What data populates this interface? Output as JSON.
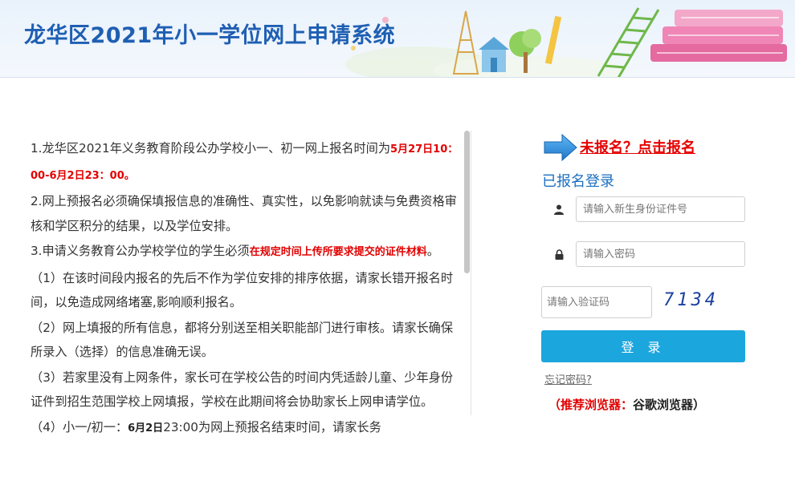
{
  "header": {
    "title": "龙华区2021年小一学位网上申请系统"
  },
  "notice": {
    "p1_text": "1.龙华区2021年义务教育阶段公办学校小一、初一网上报名时间为",
    "p1_highlight": "5月27日10：00-6月2日23：00。",
    "p2_text": "2.网上预报名必须确保填报信息的准确性、真实性，以免影响就读与免费资格审核和学区积分的结果，以及学位安排。",
    "p3_text": "3.申请义务教育公办学校学位的学生必须",
    "p3_highlight": "在规定时间上传所要求提交的证件材料",
    "p3_end": "。",
    "item1": "（1）在该时间段内报名的先后不作为学位安排的排序依据，请家长错开报名时间，以免造成网络堵塞,影响顺利报名。",
    "item2": "（2）网上填报的所有信息，都将分别送至相关职能部门进行审核。请家长确保所录入（选择）的信息准确无误。",
    "item3": "（3）若家里没有上网条件，家长可在学校公告的时间内凭适龄儿童、少年身份证件到招生范围学校上网填报，学校在此期间将会协助家长上网申请学位。",
    "item4_prefix": "（4）小一/初一：",
    "item4_bold": "6月2日",
    "item4_rest": "23:00为网上预报名结束时间，请家长务"
  },
  "login": {
    "register_link": "未报名？点击报名",
    "section_title": "已报名登录",
    "id_placeholder": "请输入新生身份证件号",
    "password_placeholder": "请输入密码",
    "captcha_placeholder": "请输入验证码",
    "captcha_code": "7134",
    "login_button": "登 录",
    "forgot_password": "忘记密码?",
    "browser_label": "（推荐浏览器：",
    "browser_value": "谷歌浏览器）"
  },
  "colors": {
    "brand_blue": "#1f5fb3",
    "button_blue": "#1ba6de",
    "alert_red": "#e20000"
  }
}
